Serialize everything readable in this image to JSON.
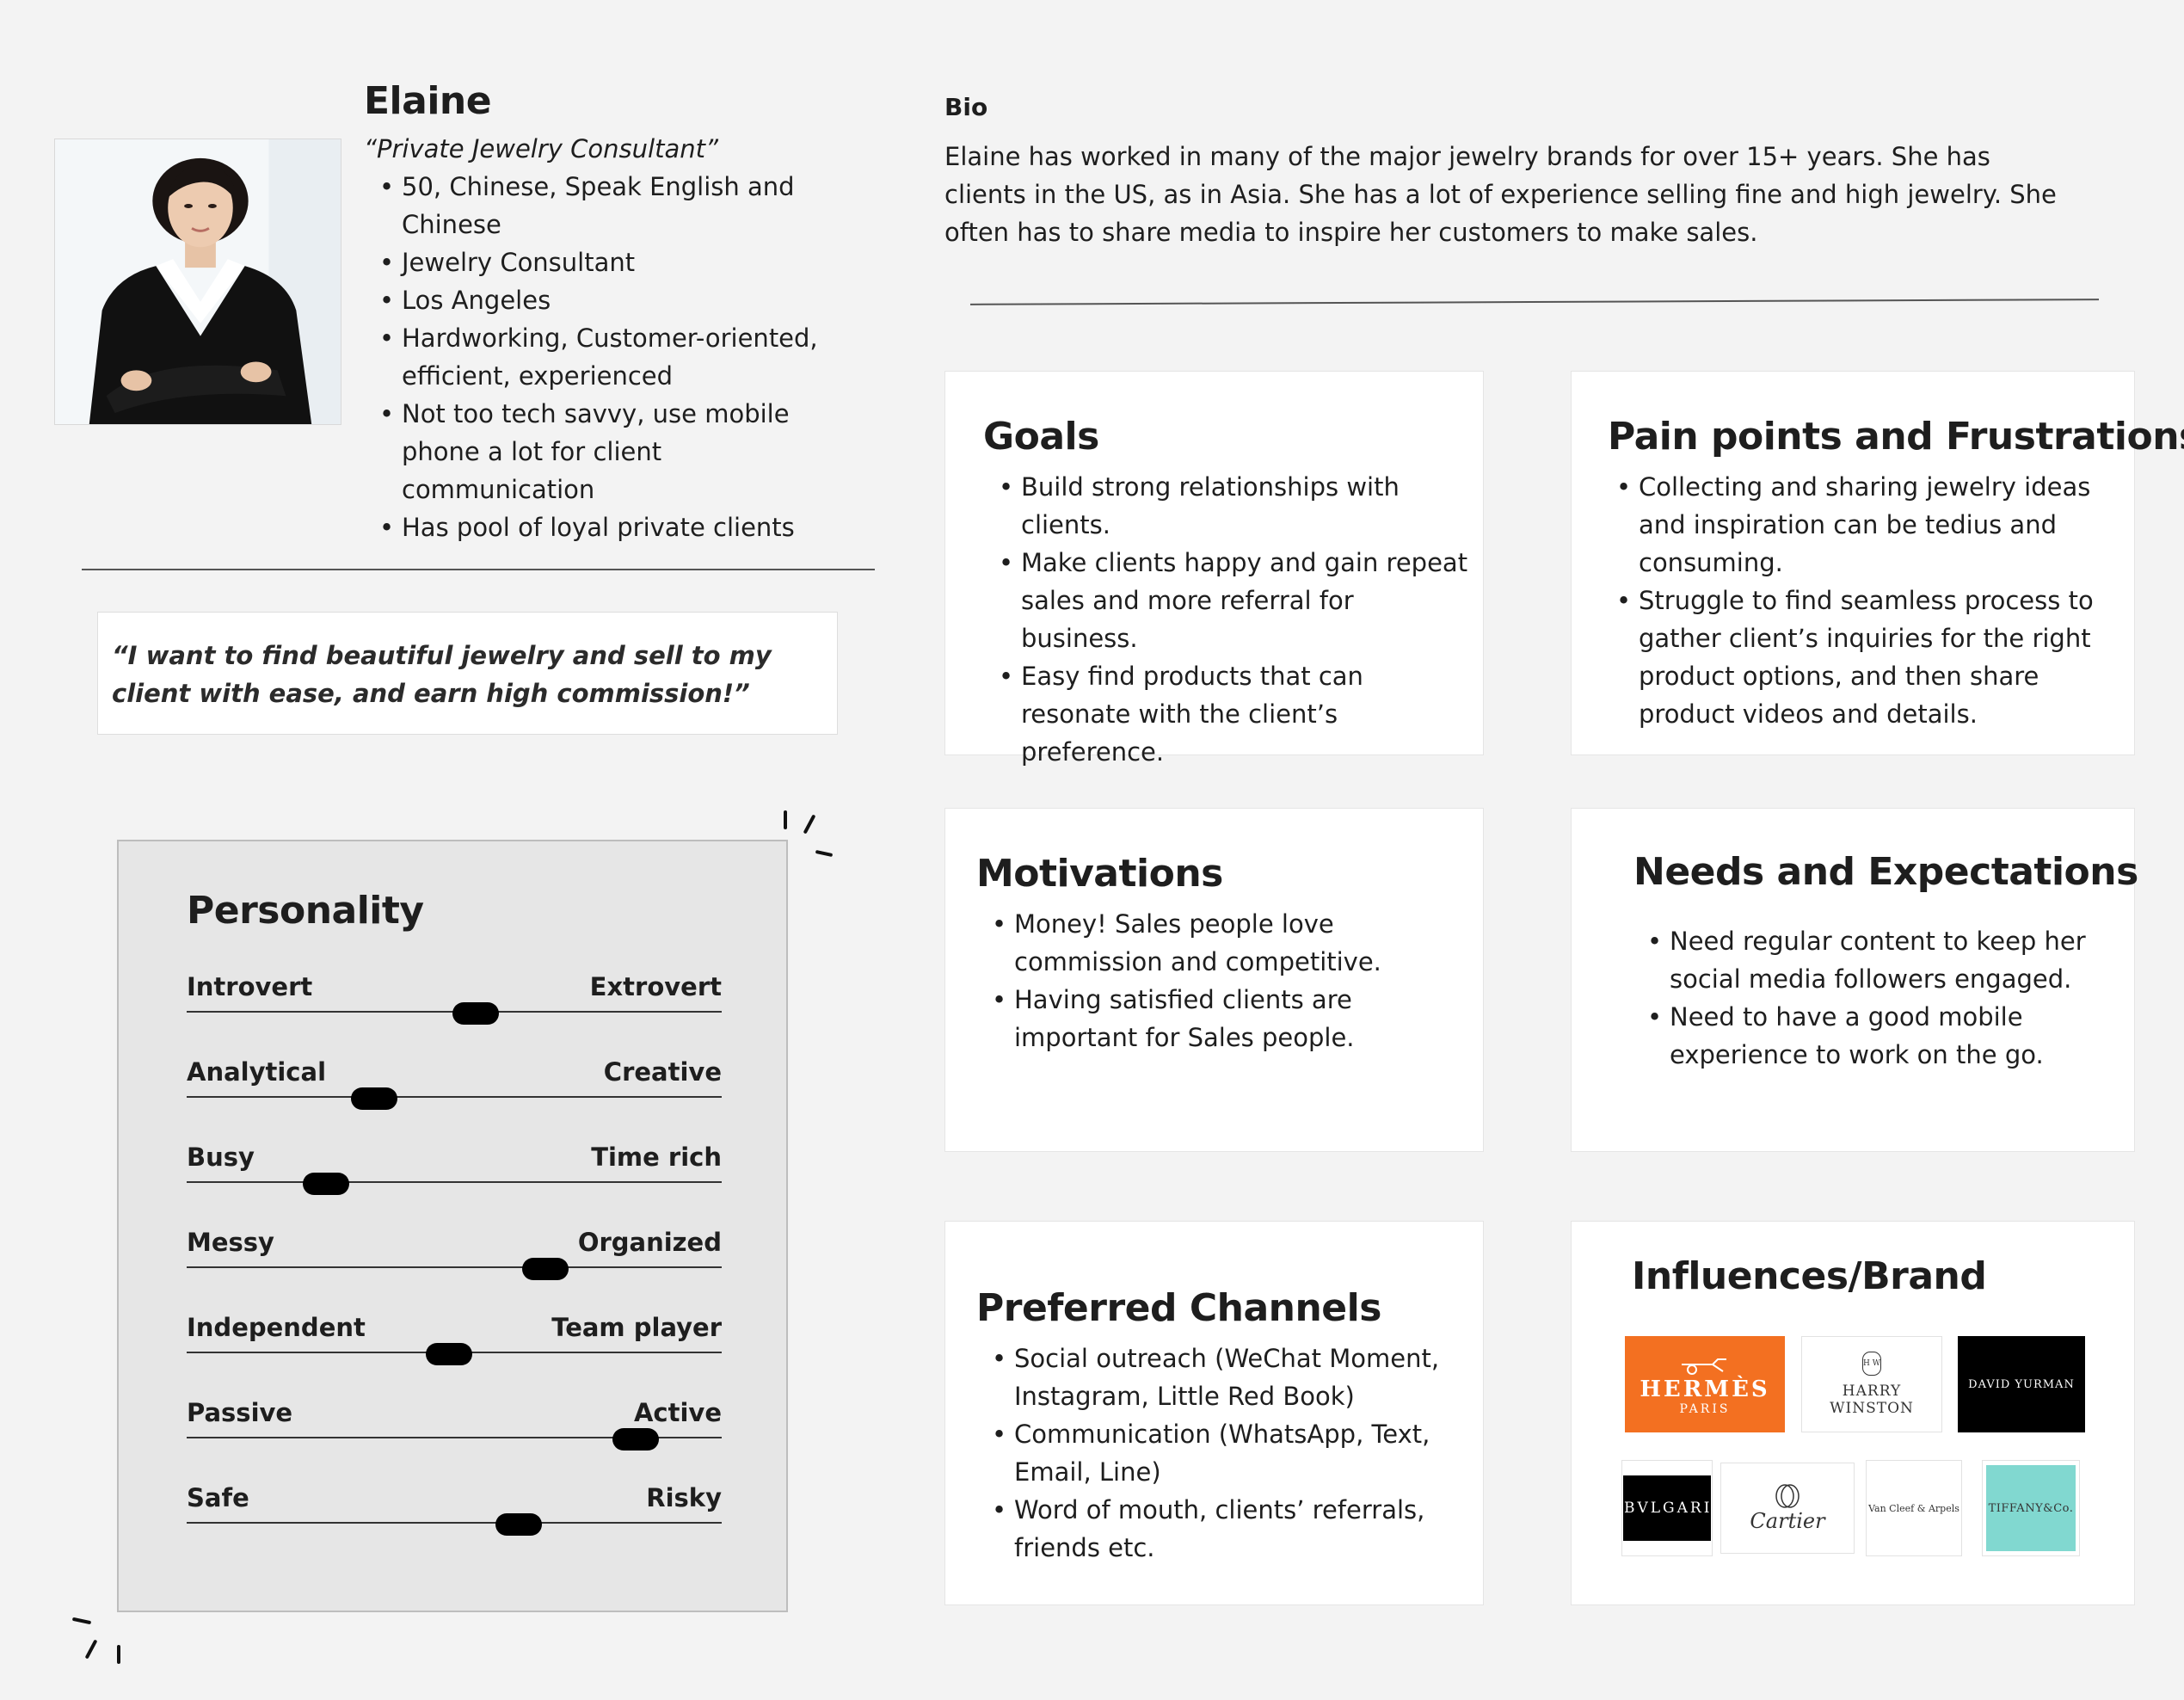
{
  "profile": {
    "name": "Elaine",
    "role": "“Private Jewelry Consultant”",
    "facts": [
      "50, Chinese, Speak English and Chinese",
      "Jewelry Consultant",
      "Los Angeles",
      "Hardworking, Customer-oriented, efficient, experienced",
      "Not too tech savvy, use mobile phone a lot for client communication",
      "Has pool of loyal private clients"
    ]
  },
  "quote": "“I want to find beautiful jewelry and sell to my client with ease, and earn high commission!”",
  "personality": {
    "title": "Personality",
    "traits": [
      {
        "left": "Introvert",
        "right": "Extrovert",
        "level": 0.54
      },
      {
        "left": "Analytical",
        "right": "Creative",
        "level": 0.35
      },
      {
        "left": "Busy",
        "right": "Time rich",
        "level": 0.26
      },
      {
        "left": "Messy",
        "right": "Organized",
        "level": 0.67
      },
      {
        "left": "Independent",
        "right": "Team player",
        "level": 0.49
      },
      {
        "left": "Passive",
        "right": "Active",
        "level": 0.84
      },
      {
        "left": "Safe",
        "right": "Risky",
        "level": 0.62
      }
    ]
  },
  "bio": {
    "label": "Bio",
    "text": "Elaine has worked in many of the major jewelry brands for over 15+ years. She has clients in the US, as in Asia. She has a lot of experience selling fine and high jewelry. She often has to share media to inspire her customers to make sales."
  },
  "goals": {
    "title": "Goals",
    "items": [
      "Build strong relationships with clients.",
      "Make clients happy and gain repeat sales and more referral for business.",
      "Easy find products that can resonate with the client’s preference."
    ]
  },
  "pain_points": {
    "title": "Pain points and Frustrations",
    "items": [
      "Collecting and sharing jewelry ideas and inspiration can be tedius and consuming.",
      "Struggle to find seamless process to gather client’s inquiries for the right product options, and then share product videos and details."
    ]
  },
  "motivations": {
    "title": "Motivations",
    "items": [
      "Money! Sales people love commission and competitive.",
      "Having satisfied clients are important for Sales people."
    ]
  },
  "needs": {
    "title": "Needs and Expectations",
    "items": [
      "Need regular content to keep her social media followers engaged.",
      "Need to have a good mobile experience to work on the go."
    ]
  },
  "channels": {
    "title": "Preferred Channels",
    "items": [
      "Social outreach (WeChat Moment, Instagram, Little Red Book)",
      "Communication (WhatsApp, Text, Email, Line)",
      "Word of mouth, clients’ referrals, friends etc."
    ]
  },
  "influences": {
    "title": "Influences/Brand",
    "brands": {
      "hermes": {
        "name": "HERMÈS",
        "sub": "PARIS"
      },
      "harry_winston": {
        "mark": "H W",
        "name": "HARRY WINSTON"
      },
      "david_yurman": {
        "name": "DAVID YURMAN"
      },
      "bvlgari": {
        "name": "BVLGARI"
      },
      "cartier": {
        "name": "Cartier"
      },
      "van_cleef": {
        "name": "Van Cleef & Arpels"
      },
      "tiffany": {
        "name": "TIFFANY&Co."
      }
    },
    "colors": {
      "hermes": "#f37021",
      "tiffany": "#81d8d0",
      "black": "#000000"
    }
  }
}
